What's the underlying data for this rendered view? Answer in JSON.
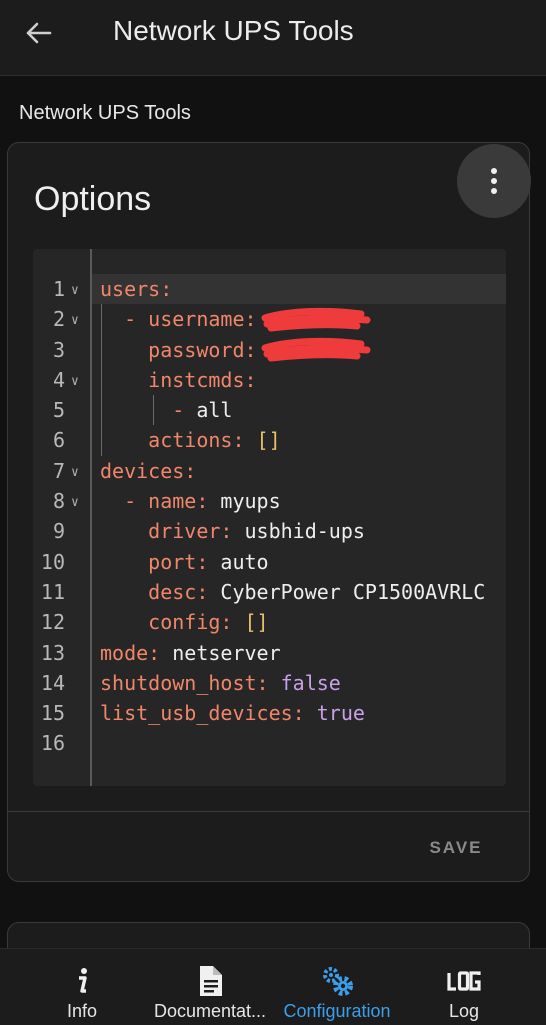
{
  "header": {
    "title": "Network UPS Tools"
  },
  "section": {
    "title": "Network UPS Tools"
  },
  "card": {
    "title": "Options",
    "save_label": "SAVE",
    "menu_icon": "dots-vertical-icon"
  },
  "editor": {
    "lines": [
      {
        "n": "1",
        "fold": "v",
        "parts": [
          {
            "t": "users:",
            "c": "k"
          }
        ]
      },
      {
        "n": "2",
        "fold": "v",
        "parts": [
          {
            "t": "  - ",
            "c": "k"
          },
          {
            "t": "username:",
            "c": "k"
          }
        ],
        "redacted": true
      },
      {
        "n": "3",
        "fold": "",
        "parts": [
          {
            "t": "    password:",
            "c": "k"
          }
        ],
        "redacted": true
      },
      {
        "n": "4",
        "fold": "v",
        "parts": [
          {
            "t": "    instcmds:",
            "c": "k"
          }
        ]
      },
      {
        "n": "5",
        "fold": "",
        "parts": [
          {
            "t": "      - ",
            "c": "k"
          },
          {
            "t": "all",
            "c": "v"
          }
        ]
      },
      {
        "n": "6",
        "fold": "",
        "parts": [
          {
            "t": "    actions: ",
            "c": "k"
          },
          {
            "t": "[]",
            "c": "br"
          }
        ]
      },
      {
        "n": "7",
        "fold": "v",
        "parts": [
          {
            "t": "devices:",
            "c": "k"
          }
        ]
      },
      {
        "n": "8",
        "fold": "v",
        "parts": [
          {
            "t": "  - ",
            "c": "k"
          },
          {
            "t": "name: ",
            "c": "k"
          },
          {
            "t": "myups",
            "c": "v"
          }
        ]
      },
      {
        "n": "9",
        "fold": "",
        "parts": [
          {
            "t": "    driver: ",
            "c": "k"
          },
          {
            "t": "usbhid-ups",
            "c": "v"
          }
        ]
      },
      {
        "n": "10",
        "fold": "",
        "parts": [
          {
            "t": "    port: ",
            "c": "k"
          },
          {
            "t": "auto",
            "c": "v"
          }
        ]
      },
      {
        "n": "11",
        "fold": "",
        "parts": [
          {
            "t": "    desc: ",
            "c": "k"
          },
          {
            "t": "CyberPower CP1500AVRLC",
            "c": "v"
          }
        ]
      },
      {
        "n": "12",
        "fold": "",
        "parts": [
          {
            "t": "    config: ",
            "c": "k"
          },
          {
            "t": "[]",
            "c": "br"
          }
        ]
      },
      {
        "n": "13",
        "fold": "",
        "parts": [
          {
            "t": "mode: ",
            "c": "k"
          },
          {
            "t": "netserver",
            "c": "v"
          }
        ]
      },
      {
        "n": "14",
        "fold": "",
        "parts": [
          {
            "t": "shutdown_host: ",
            "c": "k"
          },
          {
            "t": "false",
            "c": "bool"
          }
        ]
      },
      {
        "n": "15",
        "fold": "",
        "parts": [
          {
            "t": "list_usb_devices: ",
            "c": "k"
          },
          {
            "t": "true",
            "c": "bool"
          }
        ]
      },
      {
        "n": "16",
        "fold": "",
        "parts": []
      }
    ]
  },
  "nav": {
    "items": [
      {
        "label": "Info",
        "icon": "info-icon"
      },
      {
        "label": "Documentat...",
        "icon": "document-icon"
      },
      {
        "label": "Configuration",
        "icon": "cogs-icon"
      },
      {
        "label": "Log",
        "icon": "log-icon"
      }
    ]
  },
  "colors": {
    "background": "#111111",
    "key": "#f0866b",
    "accent": "#3b9fea",
    "redaction": "#ef3b3b"
  }
}
